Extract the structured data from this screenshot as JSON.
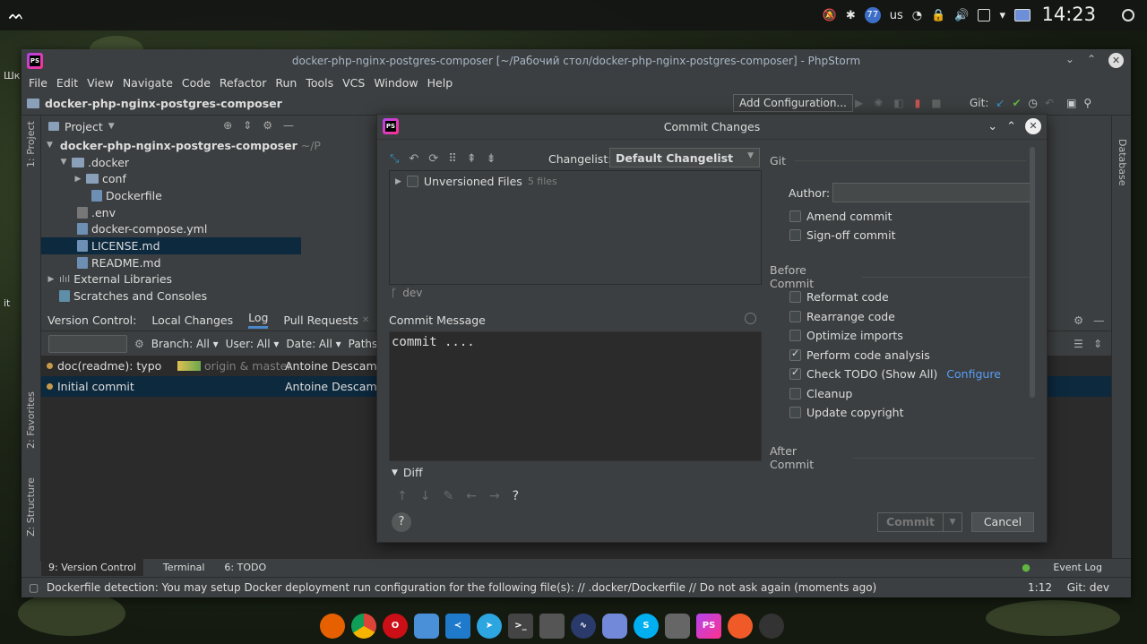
{
  "system_panel": {
    "keyboard_layout": "us",
    "notification_count": "77",
    "clock": "14:23",
    "desktop_label_left_1": "Шк",
    "desktop_label_left_2": "it"
  },
  "ide": {
    "window_title": "docker-php-nginx-postgres-composer [~/Рабочий стол/docker-php-nginx-postgres-composer] - PhpStorm",
    "menu": [
      "File",
      "Edit",
      "View",
      "Navigate",
      "Code",
      "Refactor",
      "Run",
      "Tools",
      "VCS",
      "Window",
      "Help"
    ],
    "breadcrumb": "docker-php-nginx-postgres-composer",
    "add_configuration": "Add Configuration...",
    "git_label": "Git:",
    "left_stripe": {
      "project": "1: Project",
      "favorites": "2: Favorites",
      "structure": "Z: Structure"
    },
    "right_stripe": {
      "database": "Database"
    },
    "project_panel": {
      "title": "Project",
      "tree": [
        {
          "label": "docker-php-nginx-postgres-composer",
          "suffix": "~/Р",
          "level": 0,
          "type": "folder",
          "expanded": true,
          "bold": true
        },
        {
          "label": ".docker",
          "level": 1,
          "type": "folder",
          "expanded": true
        },
        {
          "label": "conf",
          "level": 2,
          "type": "folder",
          "expanded": false
        },
        {
          "label": "Dockerfile",
          "level": 2,
          "type": "file"
        },
        {
          "label": ".env",
          "level": 1,
          "type": "file"
        },
        {
          "label": "docker-compose.yml",
          "level": 1,
          "type": "file"
        },
        {
          "label": "LICENSE.md",
          "level": 1,
          "type": "file",
          "selected": true
        },
        {
          "label": "README.md",
          "level": 1,
          "type": "file"
        },
        {
          "label": "External Libraries",
          "level": 0,
          "type": "lib",
          "expanded": false
        },
        {
          "label": "Scratches and Consoles",
          "level": 0,
          "type": "scratch"
        }
      ]
    },
    "version_control": {
      "tabs": [
        "Version Control:",
        "Local Changes",
        "Log",
        "Pull Requests"
      ],
      "active_tab": "Log",
      "filters": {
        "branch": "Branch: All ▾",
        "user": "User: All ▾",
        "date": "Date: All ▾",
        "paths": "Paths:"
      },
      "log": [
        {
          "message": "doc(readme): typo",
          "refs": "origin & master",
          "author": "Antoine Descamps"
        },
        {
          "message": "Initial commit",
          "refs": "",
          "author": "Antoine Descamps",
          "selected": true
        }
      ]
    },
    "bottom_tabs": [
      {
        "label": "9: Version Control",
        "active": true
      },
      {
        "label": "Terminal"
      },
      {
        "label": "6: TODO"
      }
    ],
    "event_log": "Event Log",
    "status": {
      "message": "Dockerfile detection: You may setup Docker deployment run configuration for the following file(s): // .docker/Dockerfile // Do not ask again (moments ago)",
      "position": "1:12",
      "git_branch": "Git: dev"
    }
  },
  "commit_dialog": {
    "title": "Commit Changes",
    "changelist_label": "Changelist:",
    "changelist_value": "Default Changelist",
    "unversioned": {
      "label": "Unversioned Files",
      "count": "5 files"
    },
    "branch": "dev",
    "commit_message_label": "Commit Message",
    "commit_message": "commit ....",
    "diff_label": "Diff",
    "git_section": "Git",
    "author_label": "Author:",
    "author_value": "",
    "git_options": [
      {
        "label": "Amend commit",
        "checked": false
      },
      {
        "label": "Sign-off commit",
        "checked": false
      }
    ],
    "before_commit_label": "Before Commit",
    "before_commit": [
      {
        "label": "Reformat code",
        "checked": false
      },
      {
        "label": "Rearrange code",
        "checked": false
      },
      {
        "label": "Optimize imports",
        "checked": false
      },
      {
        "label": "Perform code analysis",
        "checked": true
      },
      {
        "label": "Check TODO (Show All)",
        "checked": true,
        "link": "Configure"
      },
      {
        "label": "Cleanup",
        "checked": false
      },
      {
        "label": "Update copyright",
        "checked": false
      }
    ],
    "after_commit_label": "After Commit",
    "commit_button": "Commit",
    "cancel_button": "Cancel",
    "help": "?"
  }
}
